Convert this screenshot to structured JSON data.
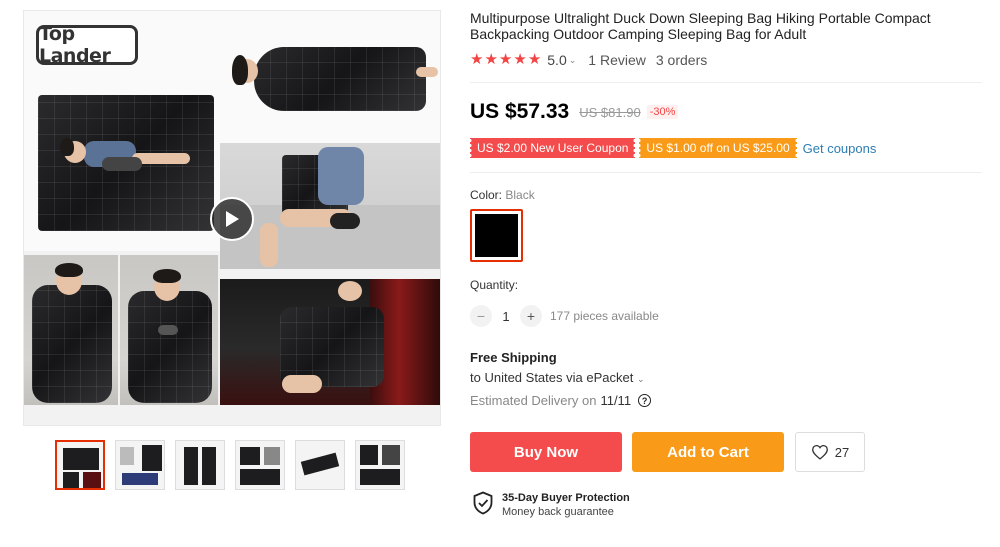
{
  "gallery": {
    "brand_logo": "Top Lander",
    "main_image_alt": "",
    "thumbnails": [
      {
        "name": "thumb-1",
        "active": true
      },
      {
        "name": "thumb-2",
        "active": false
      },
      {
        "name": "thumb-3",
        "active": false
      },
      {
        "name": "thumb-4",
        "active": false
      },
      {
        "name": "thumb-5",
        "active": false
      },
      {
        "name": "thumb-6",
        "active": false
      }
    ],
    "play_icon": "play-icon"
  },
  "product": {
    "title": "Multipurpose Ultralight Duck Down Sleeping Bag Hiking Portable Compact Backpacking Outdoor Camping Sleeping Bag for Adult",
    "rating": {
      "stars": 5,
      "score": "5.0",
      "caret": "⌄",
      "reviews": "1 Review",
      "orders": "3 orders"
    },
    "price": {
      "current": "US $57.33",
      "original": "US $81.90",
      "discount": "-30%"
    },
    "coupons": [
      {
        "label": "US $2.00 New User Coupon",
        "color": "#f44c4c"
      },
      {
        "label": "US $1.00 off on US $25.00",
        "color": "#f99b18"
      }
    ],
    "get_coupons": "Get coupons",
    "color": {
      "label": "Color: ",
      "value": "Black",
      "swatch_color": "#000000"
    },
    "quantity": {
      "label": "Quantity:",
      "value": "1",
      "minus": "−",
      "plus": "+",
      "available": "177 pieces available"
    },
    "shipping": {
      "title": "Free Shipping",
      "to": "to United States via ePacket",
      "caret": "⌄",
      "delivery_label": "Estimated Delivery on",
      "delivery_date": "11/11",
      "help_icon": "?"
    },
    "actions": {
      "buy_now": "Buy Now",
      "add_to_cart": "Add to Cart",
      "wishlist_count": "27"
    },
    "protection": {
      "title": "35-Day Buyer Protection",
      "subtitle": "Money back guarantee"
    }
  },
  "colors": {
    "accent_red": "#f44c4c",
    "accent_orange": "#f99b18",
    "link_blue": "#2e7db3"
  }
}
